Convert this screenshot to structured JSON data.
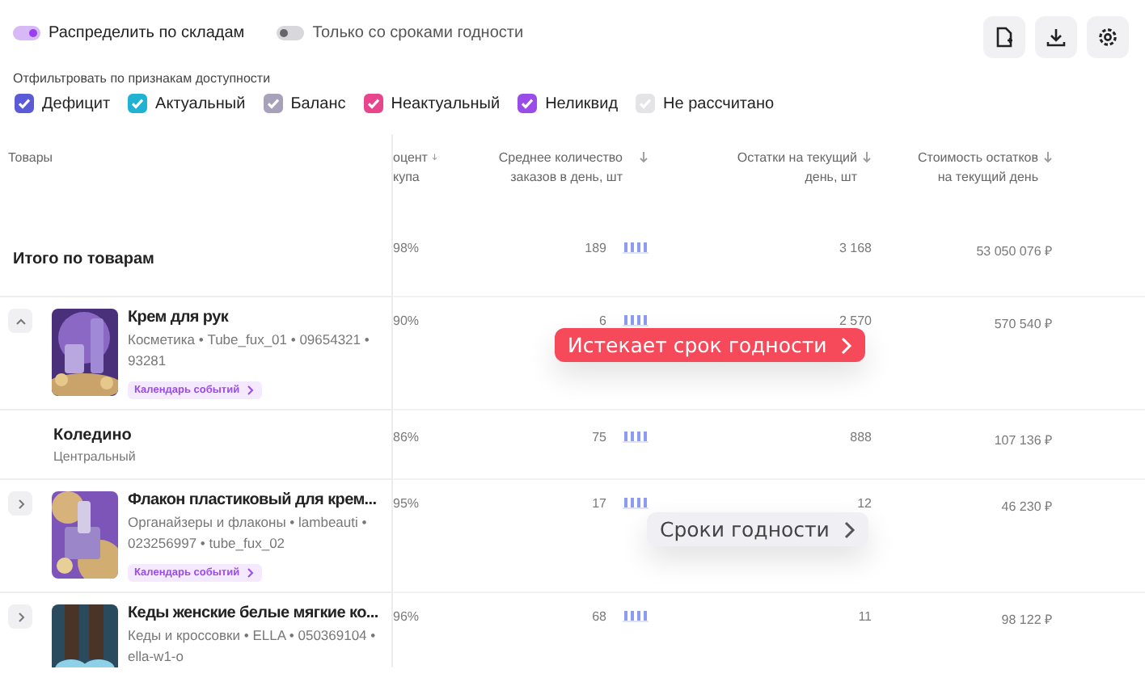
{
  "toggles": [
    {
      "label": "Распределить по складам",
      "on": true
    },
    {
      "label": "Только со сроками годности",
      "on": false
    }
  ],
  "filter": {
    "label": "Отфильтровать по признакам доступности",
    "options": [
      {
        "label": "Дефицит",
        "checked": true,
        "color": "#5b5bd6"
      },
      {
        "label": "Актуальный",
        "checked": true,
        "color": "#1fb2d3"
      },
      {
        "label": "Баланс",
        "checked": true,
        "color": "#a7a2ba"
      },
      {
        "label": "Неактуальный",
        "checked": true,
        "color": "#e8468c"
      },
      {
        "label": "Неликвид",
        "checked": true,
        "color": "#9a4ce8"
      },
      {
        "label": "Не рассчитано",
        "checked": true,
        "color": "#e4e4e6"
      }
    ]
  },
  "table": {
    "first_column": "Товары",
    "columns": [
      {
        "label": "оцент\nкупа"
      },
      {
        "label": "Среднее количество\nзаказов в день, шт"
      },
      {
        "label": "Остатки на текущий\nдень, шт"
      },
      {
        "label": "Стоимость остатков\nна текущий день"
      }
    ],
    "rows": [
      {
        "kind": "total",
        "label": "Итого по товарам",
        "cells": [
          "98%",
          "189",
          "3 168",
          "53 050 076 ₽"
        ]
      },
      {
        "kind": "product",
        "expanded": true,
        "name": "Крем для рук",
        "meta": "Косметика • Tube_fux_01 • 09654321 • 93281",
        "event_link": "Календарь событий",
        "cells": [
          "90%",
          "6",
          "2 570",
          "570 540 ₽"
        ]
      },
      {
        "kind": "warehouse",
        "name": "Коледино",
        "region": "Центральный",
        "cells": [
          "86%",
          "75",
          "888",
          "107 136 ₽"
        ]
      },
      {
        "kind": "product",
        "expanded": false,
        "name": "Флакон пластиковый для крем...",
        "meta": "Органайзеры и флаконы • lambeauti • 023256997 • tube_fux_02",
        "event_link": "Календарь событий",
        "cells": [
          "95%",
          "17",
          "12",
          "46 230 ₽"
        ]
      },
      {
        "kind": "product",
        "expanded": false,
        "name": "Кеды женские белые мягкие ко...",
        "meta": "Кеды и кроссовки • ELLA • 050369104 • ella-w1-o",
        "cells": [
          "96%",
          "68",
          "11",
          "98 122 ₽"
        ]
      }
    ]
  },
  "overlays": [
    {
      "kind": "alert",
      "label": "Истекает срок годности"
    },
    {
      "kind": "neutral",
      "label": "Сроки годности"
    }
  ]
}
